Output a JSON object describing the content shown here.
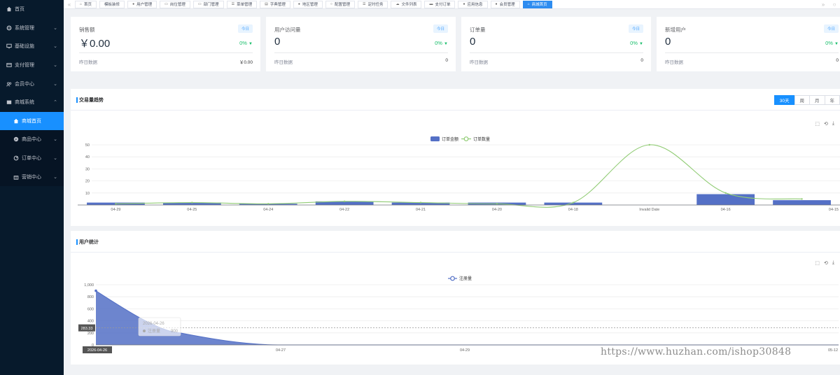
{
  "sidebar": {
    "items": [
      {
        "label": "首页",
        "icon": "home-icon"
      },
      {
        "label": "系统管理",
        "icon": "gear-icon",
        "arrow": "⌄"
      },
      {
        "label": "基础设施",
        "icon": "monitor-icon",
        "arrow": "⌄"
      },
      {
        "label": "支付管理",
        "icon": "payment-icon",
        "arrow": "⌄"
      },
      {
        "label": "会员中心",
        "icon": "users-icon",
        "arrow": "⌄"
      },
      {
        "label": "商城系统",
        "icon": "shop-icon",
        "arrow": "⌃"
      }
    ],
    "sub_items": [
      {
        "label": "商城首页",
        "icon": "home-icon",
        "active": true
      },
      {
        "label": "商品中心",
        "icon": "product-icon",
        "arrow": "⌄"
      },
      {
        "label": "订单中心",
        "icon": "order-icon",
        "arrow": "⌄"
      },
      {
        "label": "营销中心",
        "icon": "gift-icon",
        "arrow": "⌄"
      }
    ]
  },
  "tabs": [
    {
      "label": "首页",
      "icon": "home-icon"
    },
    {
      "label": "模板装修",
      "icon": ""
    },
    {
      "label": "用户管理",
      "icon": "user-icon"
    },
    {
      "label": "岗位管理",
      "icon": "post-icon"
    },
    {
      "label": "部门管理",
      "icon": "dept-icon"
    },
    {
      "label": "菜单管理",
      "icon": "menu-icon"
    },
    {
      "label": "字典管理",
      "icon": "dict-icon"
    },
    {
      "label": "地区管理",
      "icon": "location-icon"
    },
    {
      "label": "配置管理",
      "icon": "config-icon"
    },
    {
      "label": "定时任务",
      "icon": "task-icon"
    },
    {
      "label": "文件列表",
      "icon": "cloud-icon"
    },
    {
      "label": "支付订单",
      "icon": "card-icon"
    },
    {
      "label": "应用信息",
      "icon": "apple-icon"
    },
    {
      "label": "会员管理",
      "icon": "member-icon"
    },
    {
      "label": "商城首页",
      "icon": "home-icon",
      "active": true
    }
  ],
  "stats": [
    {
      "title": "销售额",
      "badge": "今日",
      "value": "￥0.00",
      "percent": "0%",
      "yesterday_label": "昨日数据",
      "yesterday_value": "￥0.00"
    },
    {
      "title": "用户访问量",
      "badge": "今日",
      "value": "0",
      "percent": "0%",
      "yesterday_label": "昨日数据",
      "yesterday_value": "0"
    },
    {
      "title": "订单量",
      "badge": "今日",
      "value": "0",
      "percent": "0%",
      "yesterday_label": "昨日数据",
      "yesterday_value": "0"
    },
    {
      "title": "新增用户",
      "badge": "今日",
      "value": "0",
      "percent": "0%",
      "yesterday_label": "昨日数据",
      "yesterday_value": "0"
    }
  ],
  "trade_panel": {
    "title": "交易量趋势",
    "ranges": [
      "30天",
      "周",
      "月",
      "年"
    ],
    "active_range": "30天"
  },
  "user_panel": {
    "title": "用户统计"
  },
  "colors": {
    "bar": "#5470c6",
    "line": "#91cc75",
    "area": "#5470c6",
    "accent": "#1890ff",
    "sidebar": "#071a2c"
  },
  "chart_data": [
    {
      "type": "bar",
      "categories": [
        "04-29",
        "04-25",
        "04-24",
        "04-22",
        "04-21",
        "04-20",
        "04-18",
        "Invalid Date",
        "04-16",
        "04-15"
      ],
      "series": [
        {
          "name": "订单金额",
          "type": "bar",
          "values": [
            2,
            2,
            1,
            3,
            2,
            2,
            2,
            0,
            9,
            4
          ]
        },
        {
          "name": "订单数量",
          "type": "line",
          "values": [
            1,
            2,
            1,
            3,
            2,
            1,
            2,
            50,
            10,
            5
          ]
        }
      ],
      "ylim": [
        0,
        50
      ],
      "yticks": [
        10,
        20,
        30,
        40,
        50
      ],
      "legend": "top-center"
    },
    {
      "type": "area",
      "x_ticks": [
        "2026-04-26",
        "04-27",
        "04-29",
        "05-12"
      ],
      "series": [
        {
          "name": "注册量",
          "values": [
            900,
            200,
            0,
            0,
            0
          ]
        }
      ],
      "ylim": [
        0,
        1000
      ],
      "yticks": [
        "0",
        "200",
        "400",
        "600",
        "800",
        "1,000"
      ],
      "avg_line_value": "283.33",
      "pointer_x_label": "2026-04-26",
      "tooltip": {
        "title": "2026-04-26",
        "series": "注册量",
        "value": "900"
      },
      "legend": "top-center"
    }
  ],
  "watermark": "https://www.huzhan.com/ishop30848"
}
